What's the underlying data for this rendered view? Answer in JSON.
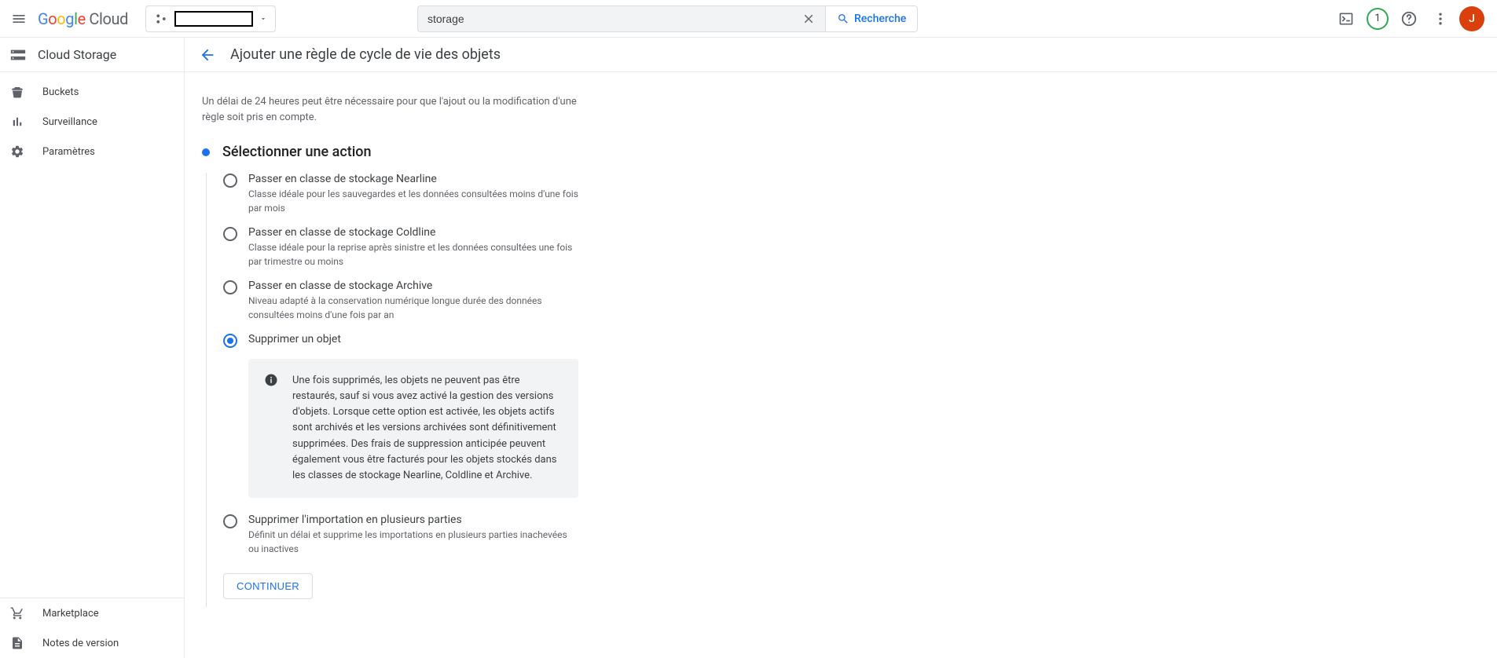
{
  "header": {
    "search_value": "storage",
    "search_button": "Recherche",
    "badge_count": "1",
    "avatar_letter": "J"
  },
  "sidebar": {
    "title": "Cloud Storage",
    "items": [
      {
        "label": "Buckets"
      },
      {
        "label": "Surveillance"
      },
      {
        "label": "Paramètres"
      }
    ],
    "footer": [
      {
        "label": "Marketplace"
      },
      {
        "label": "Notes de version"
      }
    ]
  },
  "main": {
    "title": "Ajouter une règle de cycle de vie des objets",
    "delay_text": "Un délai de 24 heures peut être nécessaire pour que l'ajout ou la modification d'une règle soit pris en compte.",
    "step_title": "Sélectionner une action",
    "options": [
      {
        "label": "Passer en classe de stockage Nearline",
        "desc": "Classe idéale pour les sauvegardes et les données consultées moins d'une fois par mois"
      },
      {
        "label": "Passer en classe de stockage Coldline",
        "desc": "Classe idéale pour la reprise après sinistre et les données consultées une fois par trimestre ou moins"
      },
      {
        "label": "Passer en classe de stockage Archive",
        "desc": "Niveau adapté à la conservation numérique longue durée des données consultées moins d'une fois par an"
      },
      {
        "label": "Supprimer un objet",
        "desc": ""
      },
      {
        "label": "Supprimer l'importation en plusieurs parties",
        "desc": "Définit un délai et supprime les importations en plusieurs parties inachevées ou inactives"
      }
    ],
    "info_text": "Une fois supprimés, les objets ne peuvent pas être restaurés, sauf si vous avez activé la gestion des versions d'objets. Lorsque cette option est activée, les objets actifs sont archivés et les versions archivées sont définitivement supprimées. Des frais de suppression anticipée peuvent également vous être facturés pour les objets stockés dans les classes de stockage Nearline, Coldline et Archive.",
    "continue": "CONTINUER"
  }
}
